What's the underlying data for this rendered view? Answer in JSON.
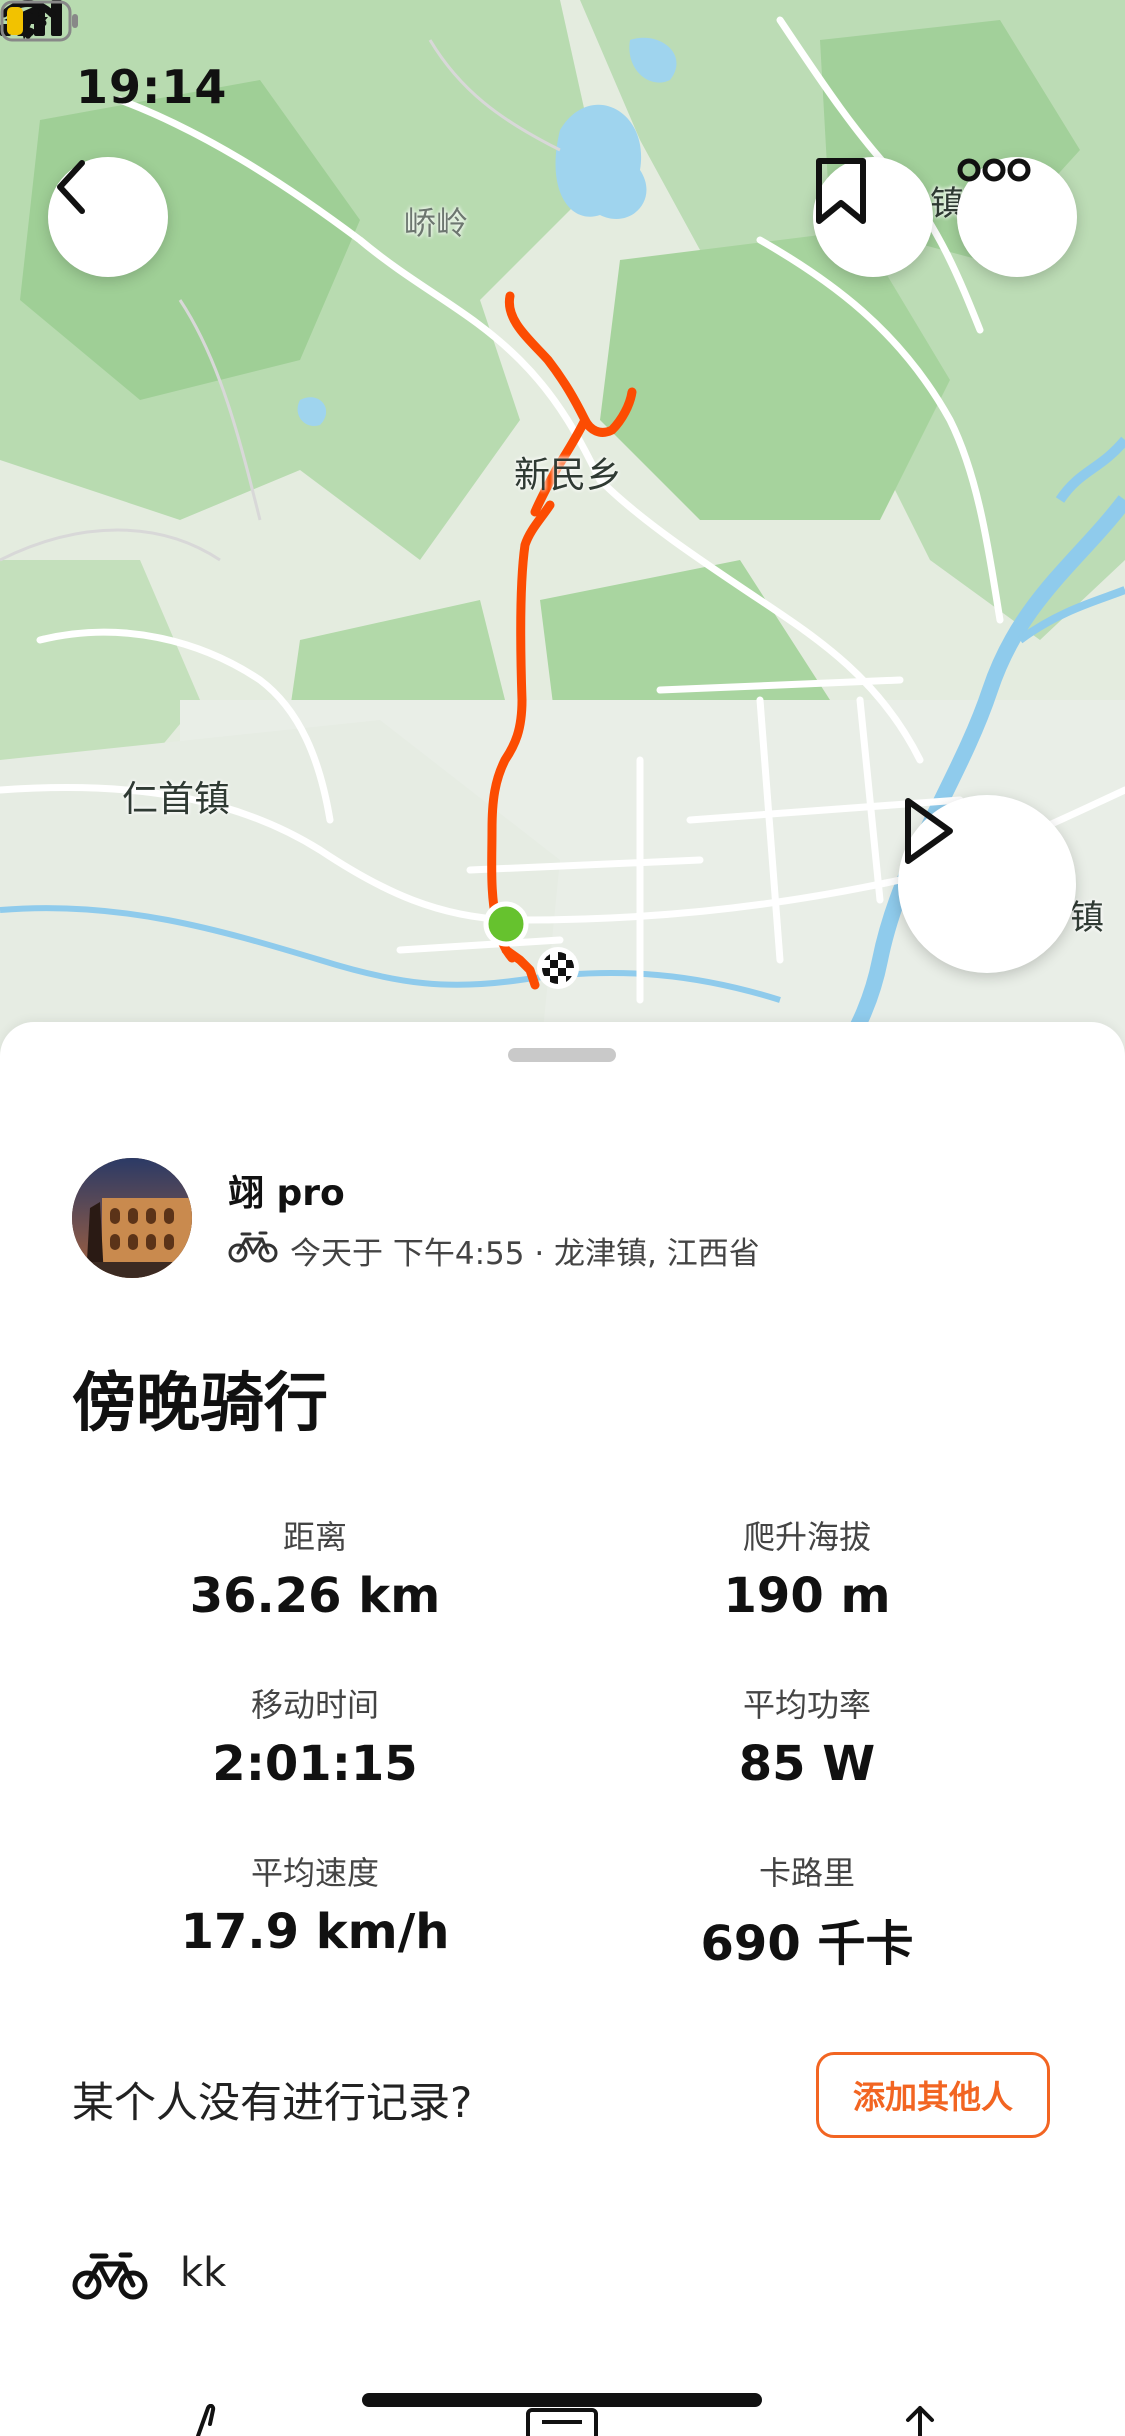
{
  "status_bar": {
    "time": "19:14"
  },
  "map": {
    "places": [
      "峤岭",
      "新民乡",
      "仁首镇",
      "镇",
      "镇"
    ],
    "route_color": "#fc4c02",
    "start_color": "#66c22e"
  },
  "athlete": {
    "name": "翊 pro",
    "meta": "今天于 下午4:55 · 龙津镇, 江西省"
  },
  "activity": {
    "title": "傍晚骑行"
  },
  "stats": [
    {
      "label": "距离",
      "value": "36.26 km"
    },
    {
      "label": "爬升海拔",
      "value": "190 m"
    },
    {
      "label": "移动时间",
      "value": "2:01:15"
    },
    {
      "label": "平均功率",
      "value": "85 W"
    },
    {
      "label": "平均速度",
      "value": "17.9 km/h"
    },
    {
      "label": "卡路里",
      "value": "690 千卡"
    }
  ],
  "missing": {
    "question": "某个人没有进行记录?",
    "add_label": "添加其他人"
  },
  "gear": {
    "name": "kk"
  },
  "colors": {
    "accent": "#f26522"
  }
}
